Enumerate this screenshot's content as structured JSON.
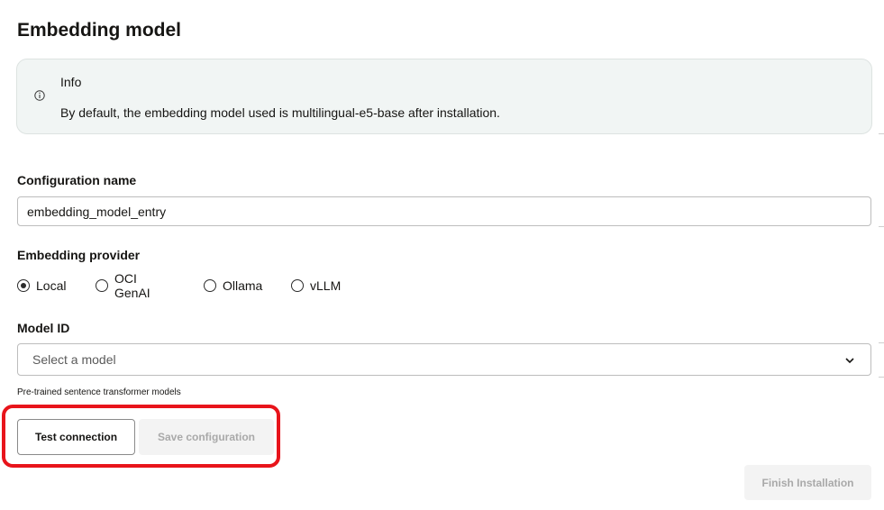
{
  "page": {
    "title": "Embedding model"
  },
  "info": {
    "icon": "info-icon",
    "heading": "Info",
    "text": "By default, the embedding model used is multilingual-e5-base after installation."
  },
  "config_name": {
    "label": "Configuration name",
    "value": "embedding_model_entry"
  },
  "provider": {
    "label": "Embedding provider",
    "selected": "Local",
    "options": [
      {
        "label": "Local",
        "checked": true
      },
      {
        "label": "OCI GenAI",
        "checked": false
      },
      {
        "label": "Ollama",
        "checked": false
      },
      {
        "label": "vLLM",
        "checked": false
      }
    ]
  },
  "model": {
    "label": "Model ID",
    "placeholder": "Select a model",
    "helper": "Pre-trained sentence transformer models"
  },
  "actions": {
    "test_label": "Test connection",
    "save_label": "Save configuration",
    "finish_label": "Finish Installation"
  },
  "colors": {
    "highlight": "#e8141b",
    "info_background": "#f1f5f4",
    "disabled_text": "#a9a9a9"
  }
}
